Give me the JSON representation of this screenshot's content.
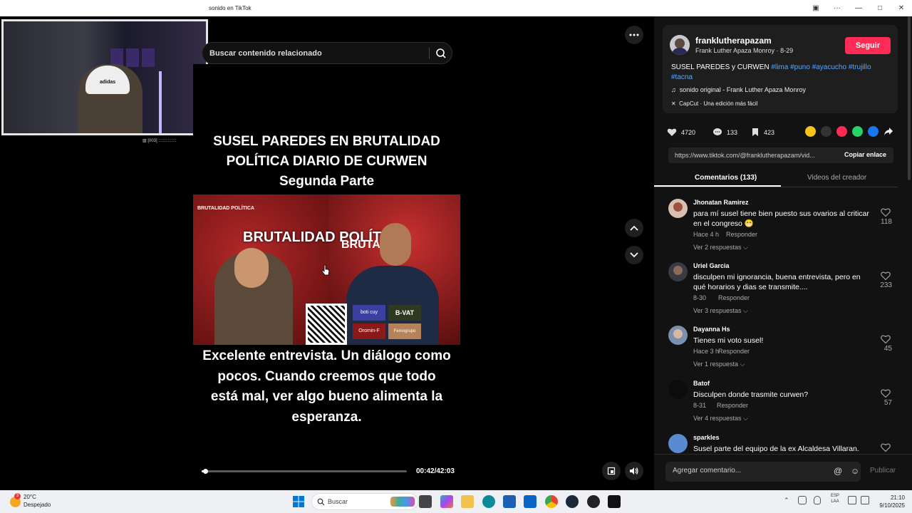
{
  "window": {
    "title": "sonido en TikTok"
  },
  "webcam": {
    "cap_brand": "adidas",
    "caption": "▧ [003] :::::::::::::::"
  },
  "search": {
    "placeholder": "Buscar contenido relacionado"
  },
  "video": {
    "title_line1": "SUSEL PAREDES EN BRUTALIDAD",
    "title_line2": "POLÍTICA DIARIO DE CURWEN",
    "title_line3": "Segunda Parte",
    "frame_logo": "BRUTALIDAD POLÍTICA",
    "frame_text_left": "BRUTALIDAD POLÍTICA",
    "frame_text_right": "BRUTA POLI",
    "sponsor_1": "boti cuy",
    "sponsor_2": "B-VAT",
    "sponsor_3": "Oromin-F",
    "sponsor_4": "Femogrupo",
    "caption_line1": "Excelente entrevista. Un diálogo como",
    "caption_line2": "pocos. Cuando creemos que todo",
    "caption_line3": "está mal, ver algo bueno alimenta la",
    "caption_line4": "esperanza.",
    "time": "00:42/42:03",
    "progress": 0.0166
  },
  "creator": {
    "username": "franklutherapazam",
    "display_name": "Frank Luther Apaza Monroy",
    "date": "8-29",
    "follow_label": "Seguir",
    "description_text": "SUSEL PAREDES y CURWEN",
    "hashtags": [
      "#lima",
      "#puno",
      "#ayacucho",
      "#trujillo",
      "#tacna"
    ],
    "music": "sonido original - Frank Luther Apaza Monroy",
    "capcut": "CapCut · Una edición más fácil"
  },
  "stats": {
    "likes": "4720",
    "comments": "133",
    "saves": "423"
  },
  "link": {
    "url": "https://www.tiktok.com/@franklutherapazam/vid...",
    "copy_label": "Copiar enlace"
  },
  "tabs": {
    "comments": "Comentarios (133)",
    "creator_videos": "Videos del creador"
  },
  "comments": [
    {
      "name": "Jhonatan Ramirez",
      "text": "para mí susel tiene bien puesto sus ovarios al criticar en el congreso 😁",
      "time": "Hace 4 h",
      "reply": "Responder",
      "more": "Ver 2 respuestas ⌵",
      "likes": "118"
    },
    {
      "name": "Uriel Garcia",
      "text": "disculpen mi ignorancia, buena entrevista, pero en qué horarios y dias se transmite....",
      "time": "8-30",
      "reply": "Responder",
      "more": "Ver 3 respuestas ⌵",
      "likes": "233"
    },
    {
      "name": "Dayanna Hs",
      "text": "Tienes mi voto susel!",
      "time": "Hace 3 h",
      "reply": "Responder",
      "more": "Ver 1 respuesta ⌵",
      "likes": "45"
    },
    {
      "name": "Batof",
      "text": "Disculpen donde trasmite curwen?",
      "time": "8-31",
      "reply": "Responder",
      "more": "Ver 4 respuestas ⌵",
      "likes": "57"
    },
    {
      "name": "sparkles",
      "text": "Susel parte del equipo de la ex Alcaldesa Villaran.",
      "time": "",
      "reply": "",
      "more": "",
      "likes": ""
    }
  ],
  "comment_input": {
    "placeholder": "Agregar comentario...",
    "post_label": "Publicar"
  },
  "taskbar": {
    "weather_badge": "3",
    "temperature": "20°C",
    "weather": "Despejado",
    "search_label": "Buscar",
    "language_line1": "ESP",
    "language_line2": "LAA",
    "time": "21:10",
    "date": "9/10/2025"
  },
  "colors": {
    "follow": "#fe2c55",
    "hashtag": "#5aa7ff",
    "video_red": "#b42828"
  }
}
